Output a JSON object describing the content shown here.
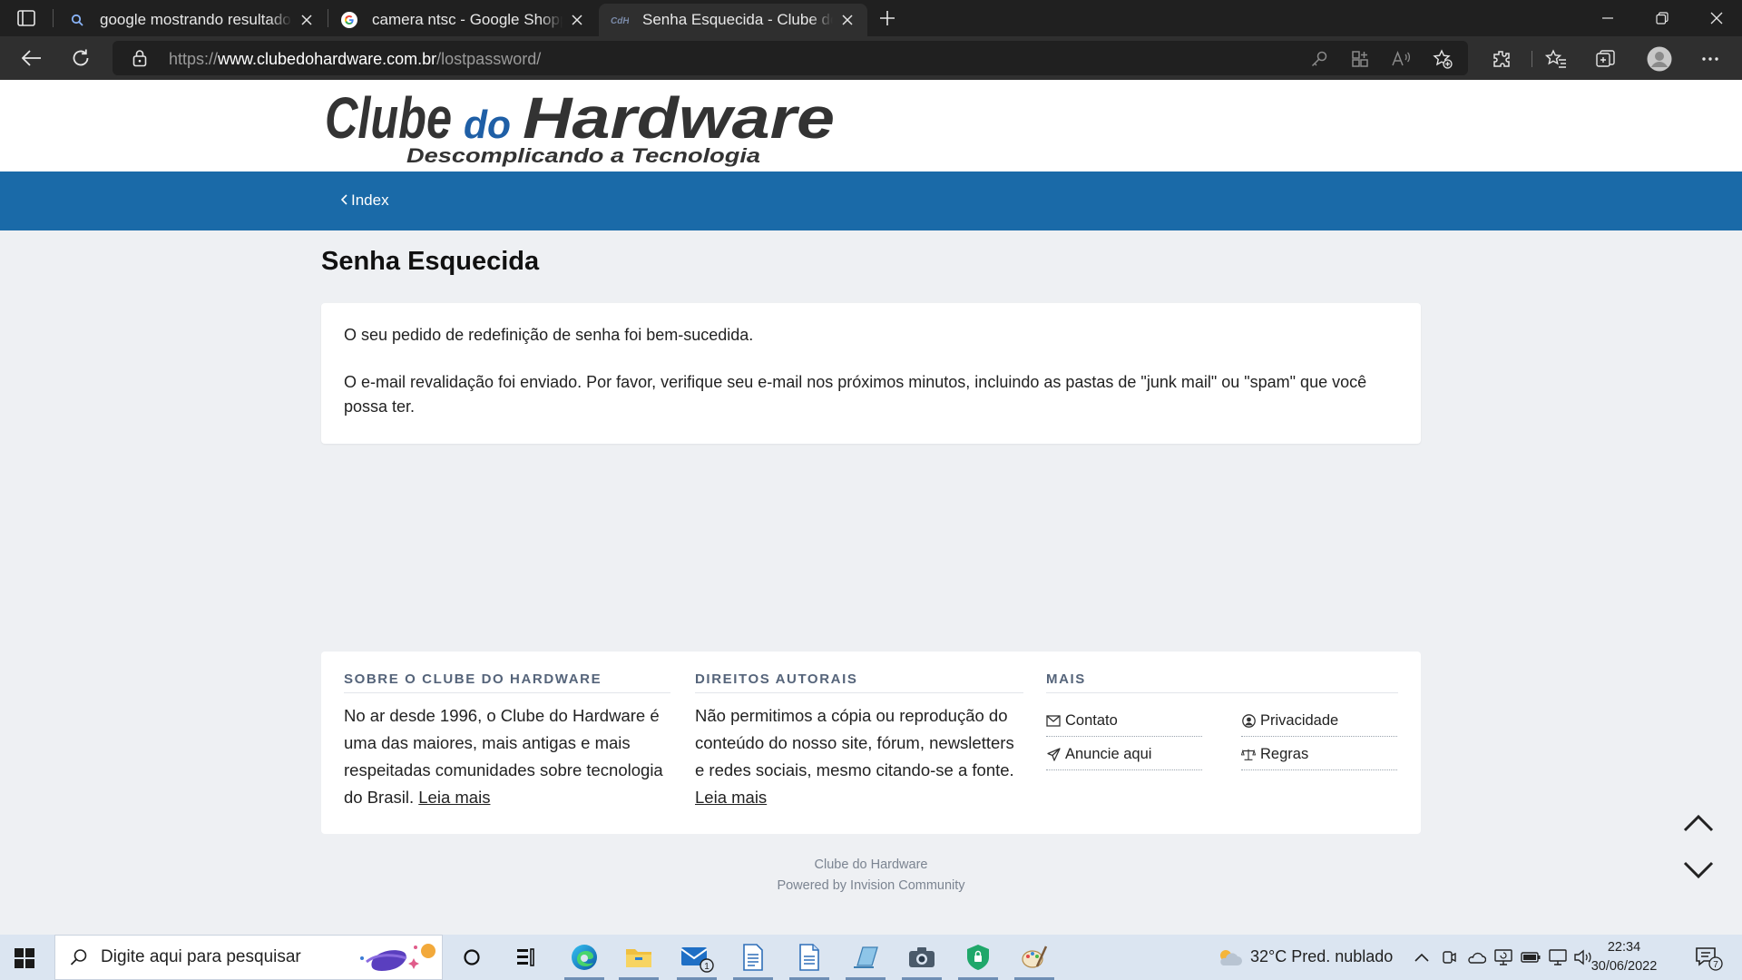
{
  "browser": {
    "tabs": [
      {
        "title": "google mostrando resultados em",
        "favicon": "search-icon",
        "active": false
      },
      {
        "title": "camera ntsc - Google Shopping",
        "favicon": "google-icon",
        "active": false
      },
      {
        "title": "Senha Esquecida - Clube do Hardware",
        "favicon": "cdh-icon",
        "active": true
      }
    ],
    "url": {
      "scheme": "https://",
      "domain": "www.clubedohardware.com.br",
      "path": "/lostpassword/"
    }
  },
  "site": {
    "logo": {
      "main_left": "Clube",
      "main_mid": "do",
      "main_right": "Hardware",
      "tagline": "Descomplicando a Tecnologia"
    },
    "breadcrumb": "Index",
    "page_title": "Senha Esquecida",
    "messages": [
      "O seu pedido de redefinição de senha foi bem-sucedida.",
      "O e-mail revalidação foi enviado. Por favor, verifique seu e-mail nos próximos minutos, incluindo as pastas de \"junk mail\" ou \"spam\" que você possa ter."
    ],
    "footer": {
      "about": {
        "heading": "SOBRE O CLUBE DO HARDWARE",
        "text": "No ar desde 1996, o Clube do Hardware é uma das maiores, mais antigas e mais respeitadas comunidades sobre tecnologia do Brasil.",
        "link": "Leia mais"
      },
      "copyright": {
        "heading": "DIREITOS AUTORAIS",
        "text": "Não permitimos a cópia ou reprodução do conteúdo do nosso site, fórum, newsletters e redes sociais, mesmo citando-se a fonte.",
        "link": "Leia mais"
      },
      "more": {
        "heading": "MAIS",
        "links": [
          "Contato",
          "Privacidade",
          "Anuncie aqui",
          "Regras"
        ]
      }
    },
    "powered_line1": "Clube do Hardware",
    "powered_line2": "Powered by Invision Community"
  },
  "taskbar": {
    "search_placeholder": "Digite aqui para pesquisar",
    "mail_badge": "1",
    "weather": "32°C  Pred. nublado",
    "time": "22:34",
    "date": "30/06/2022",
    "notification_count": "7"
  },
  "colors": {
    "nav_blue": "#1a6aa8",
    "logo_blue": "#1f5fa6",
    "logo_dark": "#333333"
  }
}
